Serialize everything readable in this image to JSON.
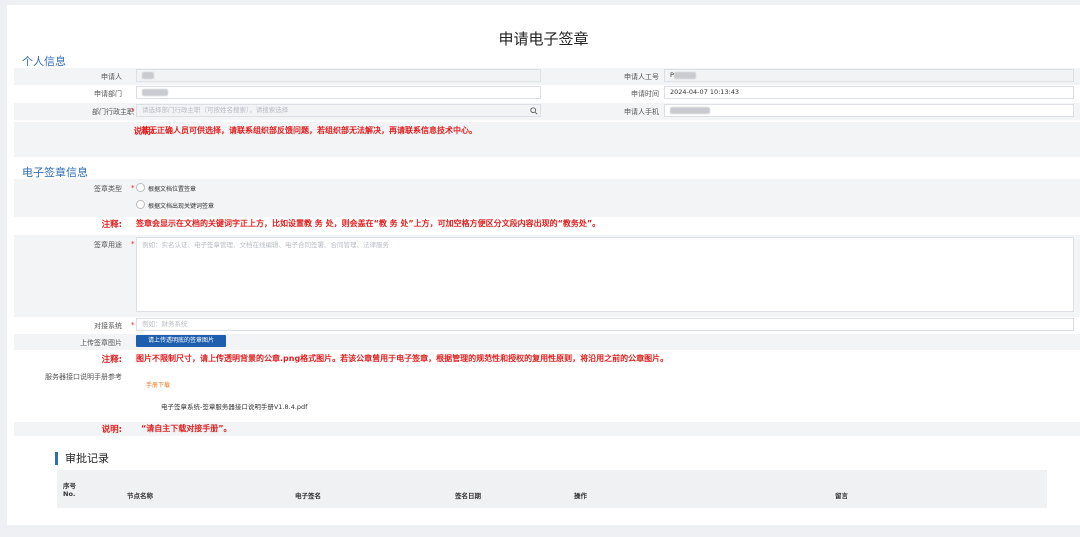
{
  "page_title": "申请电子签章",
  "personal": {
    "heading": "个人信息",
    "applicant_label": "申请人",
    "emp_id_label": "申请人工号",
    "emp_id_value": "P",
    "dept_label": "申请部门",
    "time_label": "申请时间",
    "time_value": "2024-04-07 10:13:43",
    "admin_label": "部门行政主职",
    "admin_placeholder": "请选择部门行政主职（可按姓名搜索），请搜索选择",
    "phone_label": "申请人手机",
    "note_label": "说明:",
    "note_text": "若无正确人员可供选择，请联系组织部反馈问题，若组织部无法解决，再请联系信息技术中心。"
  },
  "signature": {
    "heading": "电子签章信息",
    "type_label": "签章类型",
    "type_options": [
      "根据文档位置签章",
      "根据文档出现关键词签章"
    ],
    "note1_label": "注释:",
    "note1_text": "签章会显示在文档的关键词字正上方，比如设置教 务 处，则会盖在“教 务 处”上方，可加空格方便区分文段内容出现的“教务处”。",
    "purpose_label": "签章用途",
    "purpose_placeholder": "例如：实名认证、电子签章管理、文档在线编辑、电子合同签署、合同管理、法律服务",
    "system_label": "对接系统",
    "system_placeholder": "例如：财务系统",
    "upload_label": "上传签章图片",
    "upload_button": "请上传透明底的签章图片",
    "note2_label": "注释:",
    "note2_text": "图片不限制尺寸，请上传透明背景的公章.png格式图片。若该公章曾用于电子签章，根据管理的规范性和授权的复用性原则，将沿用之前的公章图片。",
    "manual_label": "服务器接口说明手册参考",
    "manual_download": "手册下载",
    "manual_file": "电子签章系统-签章服务器接口说明手册V1.8.4.pdf",
    "note3_label": "说明:",
    "note3_text": "“请自主下载对接手册”。"
  },
  "history": {
    "heading": "审批记录",
    "columns": {
      "seq": "序号",
      "seq_en": "No.",
      "node": "节点名称",
      "esign": "电子签名",
      "date": "签名日期",
      "op": "操作",
      "msg": "留言"
    }
  },
  "colors": {
    "accent": "#2f6db5",
    "warning": "#e02020",
    "button": "#1d5fae",
    "link": "#e87a22"
  }
}
